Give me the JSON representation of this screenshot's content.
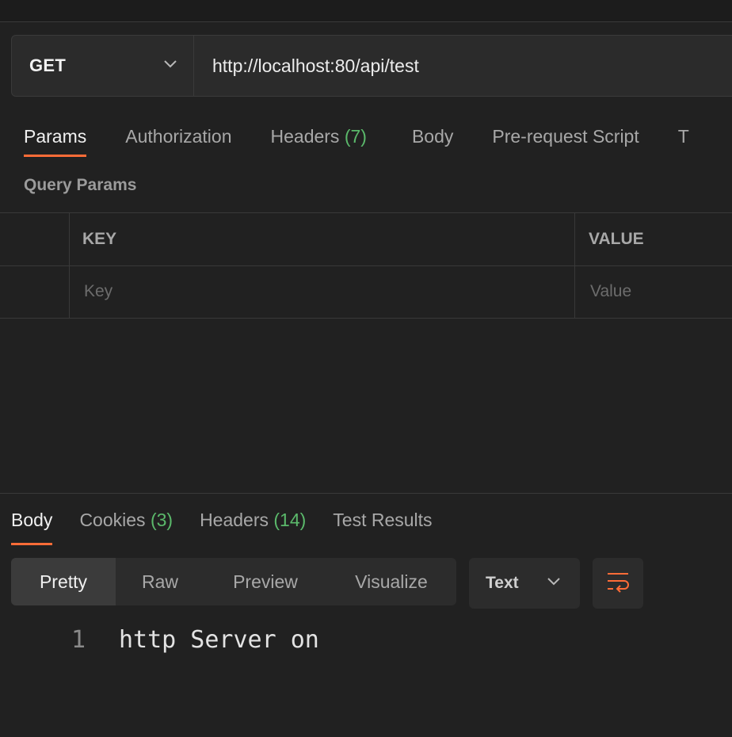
{
  "request": {
    "method": "GET",
    "url": "http://localhost:80/api/test"
  },
  "request_tabs": [
    {
      "label": "Params",
      "count": ""
    },
    {
      "label": "Authorization",
      "count": ""
    },
    {
      "label": "Headers",
      "count": "(7)"
    },
    {
      "label": "Body",
      "count": ""
    },
    {
      "label": "Pre-request Script",
      "count": ""
    },
    {
      "label": "T",
      "count": ""
    }
  ],
  "params": {
    "title": "Query Params",
    "headers": {
      "key": "KEY",
      "value": "VALUE"
    },
    "placeholders": {
      "key": "Key",
      "value": "Value"
    }
  },
  "response_tabs": [
    {
      "label": "Body",
      "count": ""
    },
    {
      "label": "Cookies",
      "count": "(3)"
    },
    {
      "label": "Headers",
      "count": "(14)"
    },
    {
      "label": "Test Results",
      "count": ""
    }
  ],
  "format": {
    "options": [
      "Pretty",
      "Raw",
      "Preview",
      "Visualize"
    ],
    "selected": "Pretty",
    "language": "Text"
  },
  "response_body": {
    "lines": [
      {
        "number": "1",
        "text": "http Server on"
      }
    ]
  },
  "colors": {
    "accent": "#ff6c37",
    "count": "#5bb96b"
  },
  "icons": {
    "method_dropdown": "chevron-down-icon",
    "language_dropdown": "chevron-down-icon",
    "wrap": "word-wrap-icon"
  }
}
